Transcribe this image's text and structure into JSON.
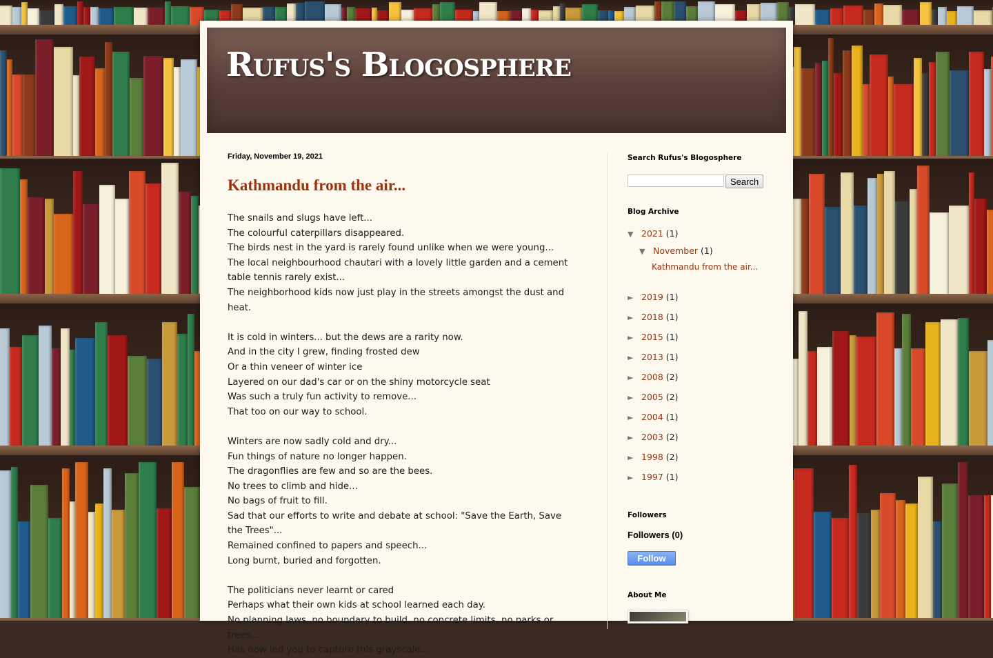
{
  "blog": {
    "title": "Rufus's Blogosphere"
  },
  "post": {
    "date": "Friday, November 19, 2021",
    "title": "Kathmandu from the air...",
    "stanzas": [
      [
        "The snails and slugs have left...",
        "The colourful caterpillars disappeared.",
        "The birds nest in the yard is rarely found unlike when we were young...",
        "The local neighbourhood chautari with a lovely little garden and a cement table tennis rarely exist...",
        "The neighborhood kids now just play in the streets amongst the dust and heat."
      ],
      [
        "It is cold in winters... but the dews are a rarity now.",
        "And in the city I grew, finding frosted dew",
        "Or a thin veneer of winter ice",
        "Layered on our dad's car or on the shiny motorcycle seat",
        "Was such a truly fun activity to remove...",
        "That too on our way to school."
      ],
      [
        "Winters are now sadly cold and dry...",
        "Fun things of nature no longer happen.",
        "The dragonflies are few and so are the bees.",
        "No trees to climb and hide...",
        "No bags of fruit to fill.",
        "Sad that our efforts to write and debate at school: \"Save the Earth, Save the Trees\"...",
        "Remained confined to papers and speech...",
        "Long burnt, buried and forgotten."
      ],
      [
        "The politicians never learnt or cared",
        "Perhaps what their own kids at school learned each day.",
        "No planning laws, no boundary to build, no concrete limits, no parks or trees...",
        "Has now led you to capture this grayscale..."
      ]
    ]
  },
  "sidebar": {
    "search": {
      "title": "Search Rufus's Blogosphere",
      "button": "Search",
      "value": ""
    },
    "archive": {
      "title": "Blog Archive",
      "expanded_year": {
        "toggle": "▼",
        "label": "2021",
        "count": "(1)"
      },
      "expanded_month": {
        "toggle": "▼",
        "label": "November",
        "count": "(1)"
      },
      "post_link": "Kathmandu from the air...",
      "years": [
        {
          "toggle": "►",
          "label": "2019",
          "count": "(1)"
        },
        {
          "toggle": "►",
          "label": "2018",
          "count": "(1)"
        },
        {
          "toggle": "►",
          "label": "2015",
          "count": "(1)"
        },
        {
          "toggle": "►",
          "label": "2013",
          "count": "(1)"
        },
        {
          "toggle": "►",
          "label": "2008",
          "count": "(2)"
        },
        {
          "toggle": "►",
          "label": "2005",
          "count": "(2)"
        },
        {
          "toggle": "►",
          "label": "2004",
          "count": "(1)"
        },
        {
          "toggle": "►",
          "label": "2003",
          "count": "(2)"
        },
        {
          "toggle": "►",
          "label": "1998",
          "count": "(2)"
        },
        {
          "toggle": "►",
          "label": "1997",
          "count": "(1)"
        }
      ]
    },
    "followers": {
      "title": "Followers",
      "subtitle": "Followers (0)",
      "button": "Follow"
    },
    "about": {
      "title": "About Me"
    }
  },
  "colors": {
    "link": "#9a3410",
    "header_bg": "#5a3f38",
    "page_bg": "#fdf9ee"
  }
}
